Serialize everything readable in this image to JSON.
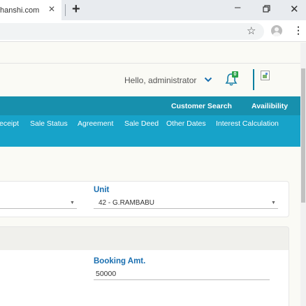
{
  "browser": {
    "tab_title": "hanshi.com",
    "tab_close": "✕",
    "new_tab": "+",
    "minimize": "–",
    "close": "✕",
    "star": "☆",
    "menu": "⋮"
  },
  "header": {
    "left_cut": ")",
    "greeting": "Hello, administrator",
    "notification_count": "0"
  },
  "nav_primary": [
    {
      "label": "Customer Search"
    },
    {
      "label": "Availibility"
    }
  ],
  "nav_secondary": [
    {
      "label": "eceipt"
    },
    {
      "label": "Sale Status"
    },
    {
      "label": "Agreement"
    },
    {
      "label": "Sale Deed"
    },
    {
      "label": "Other Dates"
    },
    {
      "label": "Interest Calculation"
    }
  ],
  "form": {
    "unit_label": "Unit",
    "unit_value": "42 - G.RAMBABU",
    "booking_label": "Booking Amt.",
    "booking_value": "50000"
  },
  "icons": {
    "bell": "bell-icon",
    "chevron": "chevron-down-icon",
    "profile": "profile-icon",
    "broken_image": "broken-image-icon"
  },
  "colors": {
    "nav_primary_bg": "#1790ad",
    "nav_secondary_bg": "#17a3c9",
    "label_blue": "#1a6fb0",
    "badge_green": "#2aa34a"
  }
}
